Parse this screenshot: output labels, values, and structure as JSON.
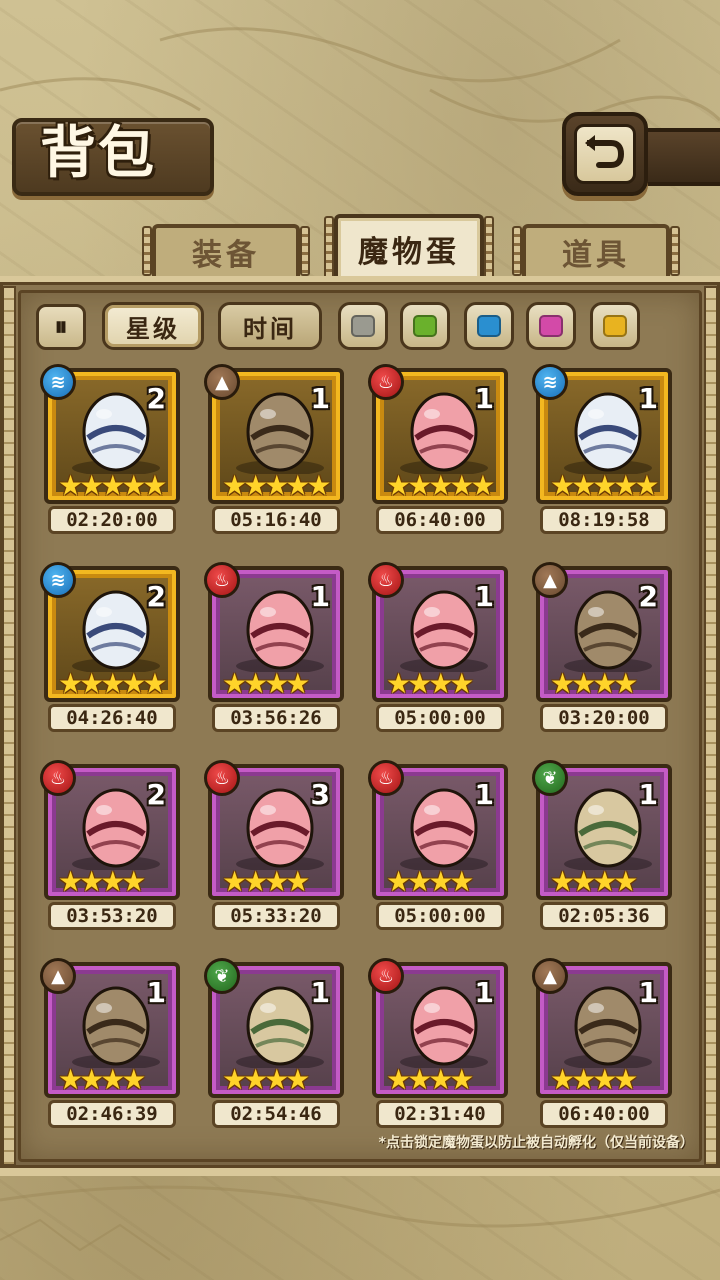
{
  "header": {
    "title": "背包",
    "back_icon": "back-arrow-icon"
  },
  "tabs": [
    {
      "label": "装备",
      "active": false
    },
    {
      "label": "魔物蛋",
      "active": true
    },
    {
      "label": "道具",
      "active": false
    }
  ],
  "filters": {
    "toggle_icon": "collapse-icon",
    "toggle_glyph": "⏸",
    "sort_star": "星级",
    "sort_time": "时间",
    "sort_active": "星级",
    "colors": [
      "#9a9a90",
      "#6ab12c",
      "#2a8fd0",
      "#d34aa8",
      "#e8b320"
    ]
  },
  "eggs": [
    {
      "element": "water",
      "element_icon": "water-element-icon",
      "rarity": "gold",
      "count": "2",
      "stars": "★★★★★",
      "timer": "02:20:00",
      "art": "white-ribbon-egg"
    },
    {
      "element": "earth",
      "element_icon": "earth-element-icon",
      "rarity": "gold",
      "count": "1",
      "stars": "★★★★★",
      "timer": "05:16:40",
      "art": "black-red-wrapped-egg"
    },
    {
      "element": "fire",
      "element_icon": "fire-element-icon",
      "rarity": "gold",
      "count": "1",
      "stars": "★★★★★",
      "timer": "06:40:00",
      "art": "dark-horned-flame-egg"
    },
    {
      "element": "water",
      "element_icon": "water-element-icon",
      "rarity": "gold",
      "count": "1",
      "stars": "★★★★★",
      "timer": "08:19:58",
      "art": "pocket-watch-egg"
    },
    {
      "element": "water",
      "element_icon": "water-element-icon",
      "rarity": "gold",
      "count": "2",
      "stars": "★★★★★",
      "timer": "04:26:40",
      "art": "dark-feather-nest-egg"
    },
    {
      "element": "fire",
      "element_icon": "fire-element-icon",
      "rarity": "purple",
      "count": "1",
      "stars": "★★★★",
      "timer": "03:56:26",
      "art": "kimono-egg"
    },
    {
      "element": "fire",
      "element_icon": "fire-element-icon",
      "rarity": "purple",
      "count": "1",
      "stars": "★★★★",
      "timer": "05:00:00",
      "art": "white-hammer-egg"
    },
    {
      "element": "earth",
      "element_icon": "earth-element-icon",
      "rarity": "purple",
      "count": "2",
      "stars": "★★★★",
      "timer": "03:20:00",
      "art": "sword-armor-egg"
    },
    {
      "element": "fire",
      "element_icon": "fire-element-icon",
      "rarity": "purple",
      "count": "2",
      "stars": "★★★★",
      "timer": "03:53:20",
      "art": "pink-winged-egg"
    },
    {
      "element": "fire",
      "element_icon": "fire-element-icon",
      "rarity": "purple",
      "count": "3",
      "stars": "★★★★",
      "timer": "05:33:20",
      "art": "dagger-egg"
    },
    {
      "element": "fire",
      "element_icon": "fire-element-icon",
      "rarity": "purple",
      "count": "1",
      "stars": "★★★★",
      "timer": "05:00:00",
      "art": "dark-hammer-egg"
    },
    {
      "element": "nature",
      "element_icon": "nature-element-icon",
      "rarity": "purple",
      "count": "1",
      "stars": "★★★★",
      "timer": "02:05:36",
      "art": "spiked-collar-egg"
    },
    {
      "element": "earth",
      "element_icon": "earth-element-icon",
      "rarity": "purple",
      "count": "1",
      "stars": "★★★★",
      "timer": "02:46:39",
      "art": "mechanical-eye-egg"
    },
    {
      "element": "nature",
      "element_icon": "nature-element-icon",
      "rarity": "purple",
      "count": "1",
      "stars": "★★★★",
      "timer": "02:54:46",
      "art": "leaf-striped-egg"
    },
    {
      "element": "fire",
      "element_icon": "fire-element-icon",
      "rarity": "purple",
      "count": "1",
      "stars": "★★★★",
      "timer": "02:31:40",
      "art": "crown-jar-egg"
    },
    {
      "element": "earth",
      "element_icon": "earth-element-icon",
      "rarity": "purple",
      "count": "1",
      "stars": "★★★★",
      "timer": "06:40:00",
      "art": "furry-nest-egg"
    }
  ],
  "footnote": "*点击锁定魔物蛋以防止被自动孵化（仅当前设备）"
}
